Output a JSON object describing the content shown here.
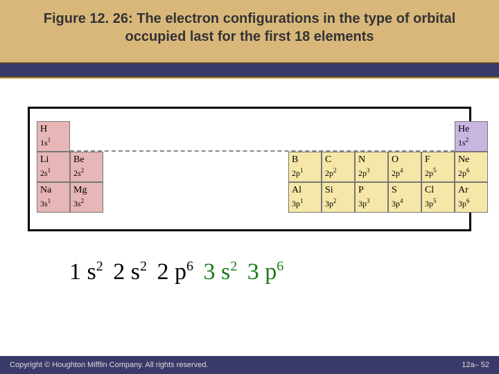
{
  "title": "Figure 12. 26:  The electron configurations in the type of orbital occupied last for the first 18 elements",
  "table": {
    "row1_left": [
      {
        "sym": "H",
        "cfg_base": "1s",
        "cfg_sup": "1"
      }
    ],
    "row1_right": [
      {
        "sym": "He",
        "cfg_base": "1s",
        "cfg_sup": "2"
      }
    ],
    "row2_left": [
      {
        "sym": "Li",
        "cfg_base": "2s",
        "cfg_sup": "1"
      },
      {
        "sym": "Be",
        "cfg_base": "2s",
        "cfg_sup": "2"
      }
    ],
    "row2_right": [
      {
        "sym": "B",
        "cfg_base": "2p",
        "cfg_sup": "1"
      },
      {
        "sym": "C",
        "cfg_base": "2p",
        "cfg_sup": "2"
      },
      {
        "sym": "N",
        "cfg_base": "2p",
        "cfg_sup": "3"
      },
      {
        "sym": "O",
        "cfg_base": "2p",
        "cfg_sup": "4"
      },
      {
        "sym": "F",
        "cfg_base": "2p",
        "cfg_sup": "5"
      },
      {
        "sym": "Ne",
        "cfg_base": "2p",
        "cfg_sup": "6"
      }
    ],
    "row3_left": [
      {
        "sym": "Na",
        "cfg_base": "3s",
        "cfg_sup": "1"
      },
      {
        "sym": "Mg",
        "cfg_base": "3s",
        "cfg_sup": "2"
      }
    ],
    "row3_right": [
      {
        "sym": "Al",
        "cfg_base": "3p",
        "cfg_sup": "1"
      },
      {
        "sym": "Si",
        "cfg_base": "3p",
        "cfg_sup": "2"
      },
      {
        "sym": "P",
        "cfg_base": "3p",
        "cfg_sup": "3"
      },
      {
        "sym": "S",
        "cfg_base": "3p",
        "cfg_sup": "4"
      },
      {
        "sym": "Cl",
        "cfg_base": "3p",
        "cfg_sup": "5"
      },
      {
        "sym": "Ar",
        "cfg_base": "3p",
        "cfg_sup": "6"
      }
    ]
  },
  "config_groups": [
    {
      "base": "1 s",
      "sup": "2",
      "color": "black"
    },
    {
      "base": "2 s",
      "sup": "2",
      "color": "black"
    },
    {
      "base": "2 p",
      "sup": "6",
      "color": "black"
    },
    {
      "base": "3 s",
      "sup": "2",
      "color": "green"
    },
    {
      "base": "3 p",
      "sup": "6",
      "color": "green"
    }
  ],
  "footer": {
    "copyright": "Copyright © Houghton Mifflin Company. All rights reserved.",
    "pageref": "12a– 52"
  }
}
